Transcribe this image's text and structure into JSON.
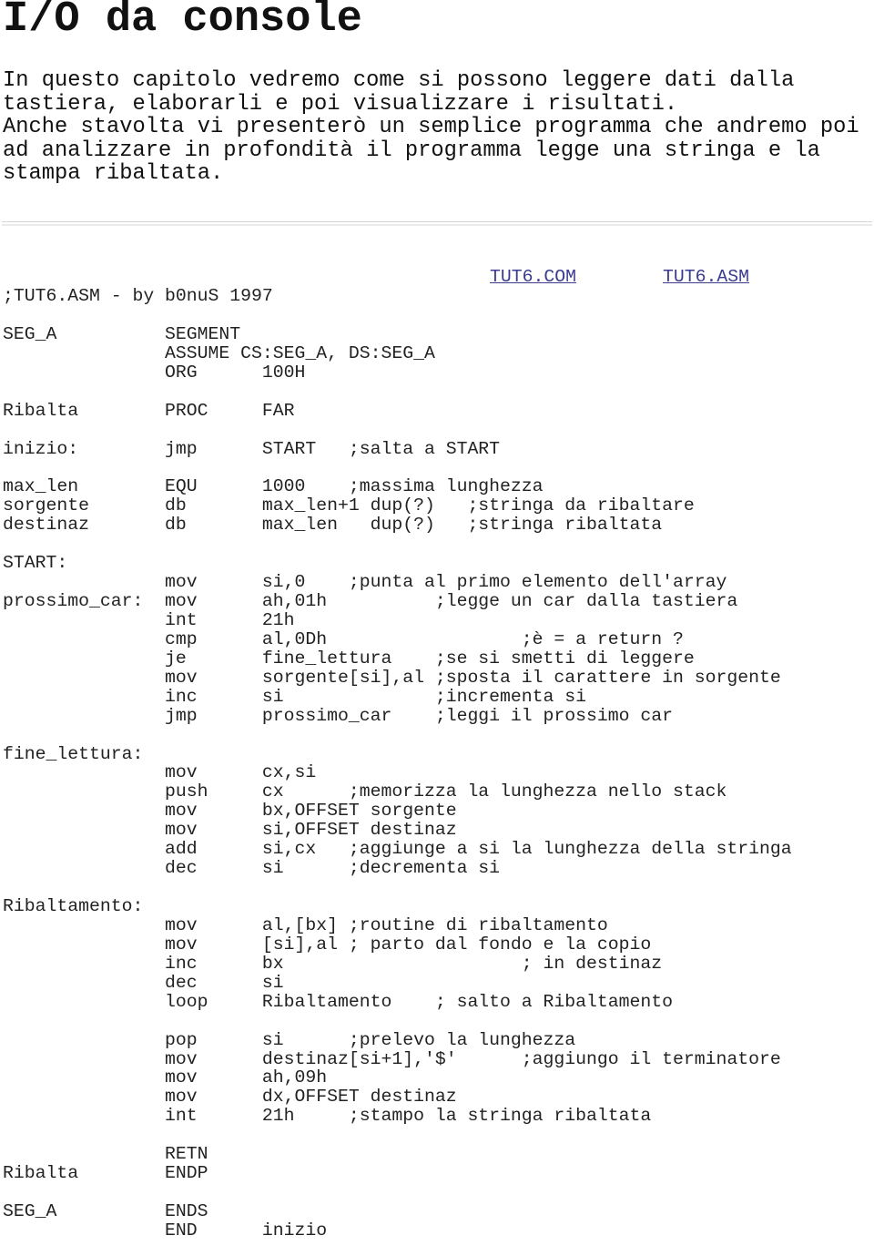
{
  "title": "I/O da console",
  "intro": "In questo capitolo vedremo come si possono leggere dati dalla tastiera, elaborarli e poi visualizzare i risultati.\nAnche stavolta vi presenterò un semplice programma che andremo poi ad analizzare in profondità il programma legge una stringa e la stampa ribaltata.",
  "links": {
    "com": "TUT6.COM",
    "asm": "TUT6.ASM"
  },
  "link_color": "#3b3b8f",
  "code_lines": [
    ";TUT6.ASM - by b0nuS 1997",
    "",
    "SEG_A          SEGMENT",
    "               ASSUME CS:SEG_A, DS:SEG_A",
    "               ORG      100H",
    "",
    "Ribalta        PROC     FAR",
    "",
    "inizio:        jmp      START   ;salta a START",
    "",
    "max_len        EQU      1000    ;massima lunghezza",
    "sorgente       db       max_len+1 dup(?)   ;stringa da ribaltare",
    "destinaz       db       max_len   dup(?)   ;stringa ribaltata",
    "",
    "START:",
    "               mov      si,0    ;punta al primo elemento dell'array",
    "prossimo_car:  mov      ah,01h          ;legge un car dalla tastiera",
    "               int      21h",
    "               cmp      al,0Dh                  ;è = a return ?",
    "               je       fine_lettura    ;se si smetti di leggere",
    "               mov      sorgente[si],al ;sposta il carattere in sorgente",
    "               inc      si              ;incrementa si",
    "               jmp      prossimo_car    ;leggi il prossimo car",
    "",
    "fine_lettura:",
    "               mov      cx,si",
    "               push     cx      ;memorizza la lunghezza nello stack",
    "               mov      bx,OFFSET sorgente",
    "               mov      si,OFFSET destinaz",
    "               add      si,cx   ;aggiunge a si la lunghezza della stringa",
    "               dec      si      ;decrementa si",
    "",
    "Ribaltamento:",
    "               mov      al,[bx] ;routine di ribaltamento",
    "               mov      [si],al ; parto dal fondo e la copio",
    "               inc      bx                      ; in destinaz",
    "               dec      si",
    "               loop     Ribaltamento    ; salto a Ribaltamento",
    "",
    "               pop      si      ;prelevo la lunghezza",
    "               mov      destinaz[si+1],'$'      ;aggiungo il terminatore",
    "               mov      ah,09h",
    "               mov      dx,OFFSET destinaz",
    "               int      21h     ;stampo la stringa ribaltata",
    "",
    "               RETN",
    "Ribalta        ENDP",
    "",
    "SEG_A          ENDS",
    "               END      inizio"
  ]
}
